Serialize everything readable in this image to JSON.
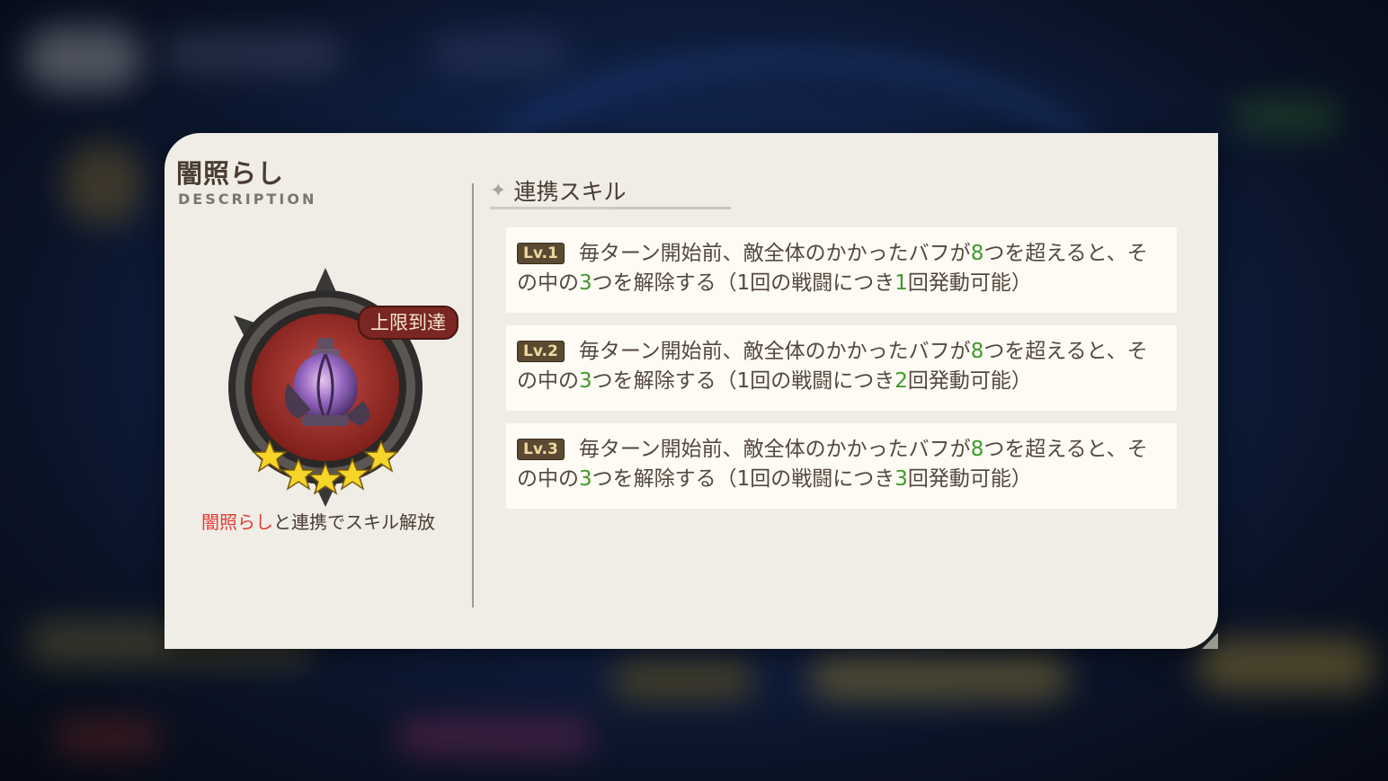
{
  "colors": {
    "card_bg": "#efede6",
    "heading_text": "#4a3c32",
    "highlight_red": "#e53a35",
    "number_green": "#3f9a2c",
    "badge_bg": "#7a2622",
    "level_tag_bg": "#5a4a32"
  },
  "panel": {
    "title": "闇照らし",
    "subtitle": "DESCRIPTION",
    "medal": {
      "icon": "lantern-orb-icon",
      "badge": "上限到達",
      "stars": 5
    },
    "unlock_text": {
      "highlight": "闇照らし",
      "rest": "と連携でスキル解放"
    }
  },
  "skills": {
    "header": "連携スキル",
    "header_icon": "sparkle-icon",
    "levels": [
      {
        "tag": "Lv.1",
        "text": [
          "毎ターン開始前、敵全体のかかったバフが",
          "8",
          "つを超えると、その中の",
          "3",
          "つを解除する（1回の戦闘につき",
          "1",
          "回発動可能）"
        ]
      },
      {
        "tag": "Lv.2",
        "text": [
          "毎ターン開始前、敵全体のかかったバフが",
          "8",
          "つを超えると、その中の",
          "3",
          "つを解除する（1回の戦闘につき",
          "2",
          "回発動可能）"
        ]
      },
      {
        "tag": "Lv.3",
        "text": [
          "毎ターン開始前、敵全体のかかったバフが",
          "8",
          "つを超えると、その中の",
          "3",
          "つを解除する（1回の戦闘につき",
          "3",
          "回発動可能）"
        ]
      }
    ]
  }
}
